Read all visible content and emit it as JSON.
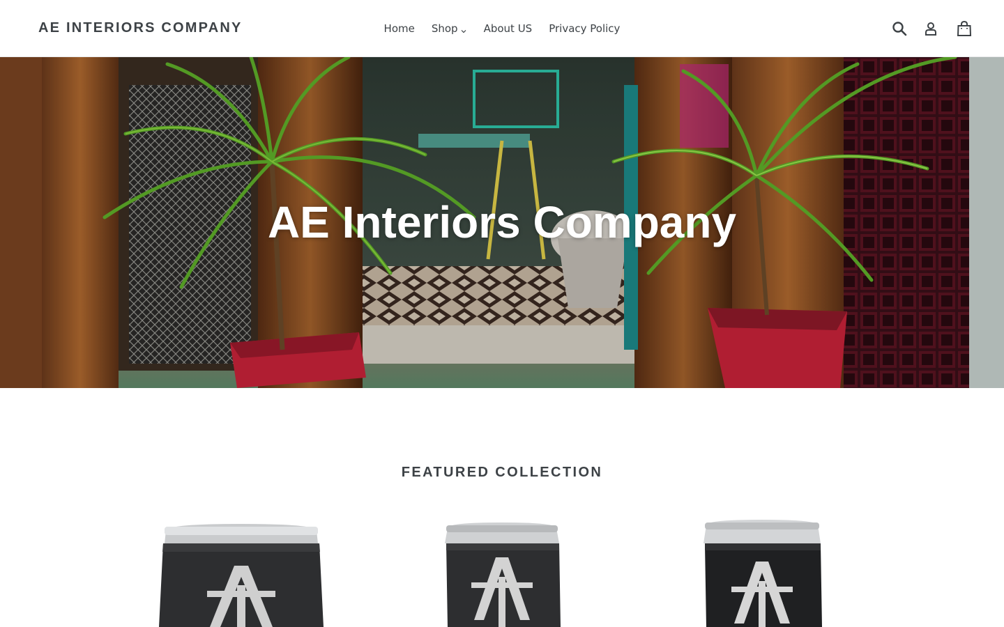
{
  "header": {
    "logo_text": "AE INTERIORS COMPANY",
    "nav": [
      {
        "label": "Home"
      },
      {
        "label": "Shop"
      },
      {
        "label": "About US"
      },
      {
        "label": "Privacy Policy"
      }
    ],
    "icons": [
      "search-icon",
      "account-icon",
      "cart-icon"
    ]
  },
  "hero": {
    "title": "AE Interiors Company"
  },
  "featured": {
    "title": "FEATURED COLLECTION",
    "products": [
      {
        "image": "tumbler-image"
      },
      {
        "image": "tumbler-image"
      },
      {
        "image": "tumbler-image"
      }
    ]
  },
  "colors": {
    "text": "#3d4246",
    "background": "#ffffff",
    "hero_title": "#ffffff"
  }
}
